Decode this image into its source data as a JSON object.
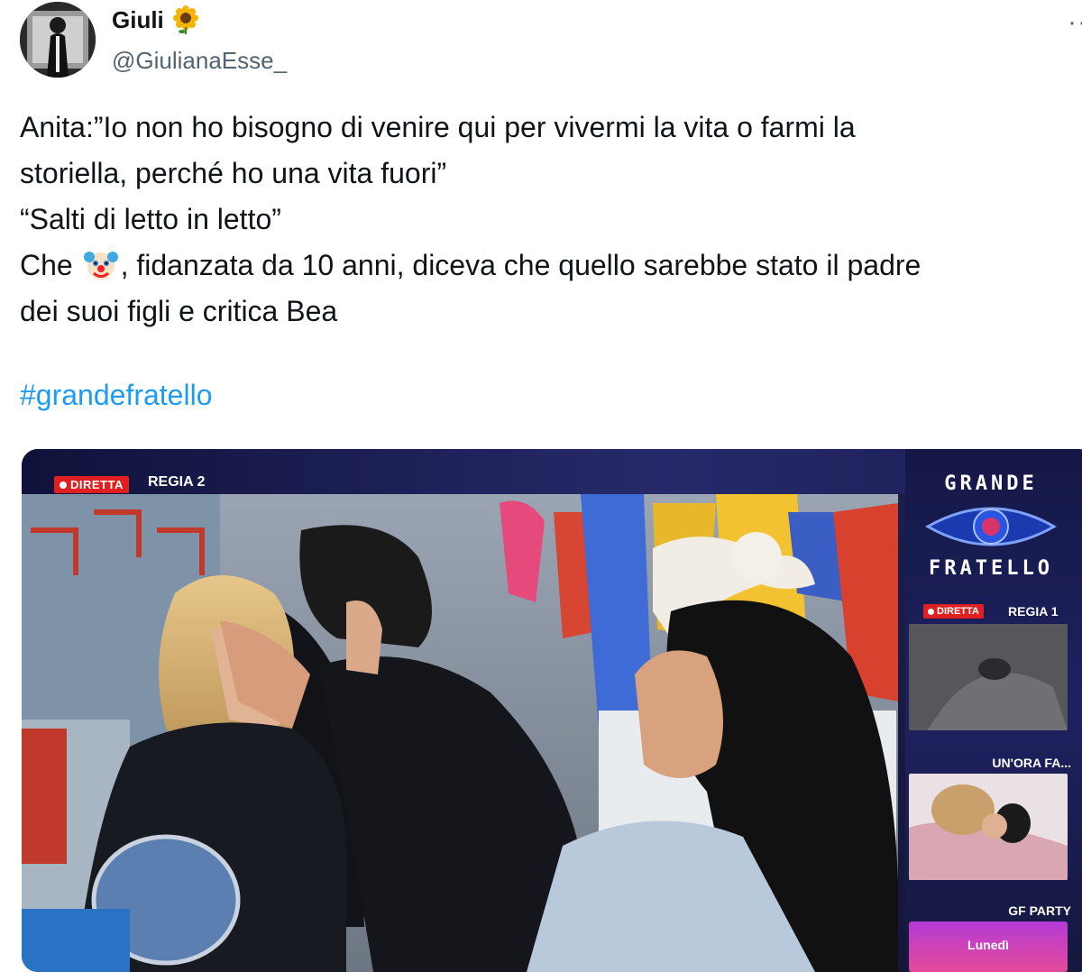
{
  "author": {
    "display_name": "Giuli",
    "name_emoji": "sunflower-emoji",
    "handle": "@GiulianaEsse_",
    "more_icon": "more-icon"
  },
  "tweet": {
    "line1": "Anita:”Io non ho bisogno di venire  qui per vivermi la vita o farmi la",
    "line2": "storiella, perché ho una vita fuori”",
    "line3": "“Salti di letto in letto”",
    "line4_before_emoji": "Che ",
    "line4_emoji": "clown-face-emoji",
    "line4_after_emoji": ", fidanzata da 10 anni, diceva che quello sarebbe stato il padre",
    "line5": "dei suoi figli e critica Bea",
    "hashtag": "#grandefratello"
  },
  "media": {
    "live_badge": "DIRETTA",
    "main_feed_label": "REGIA 2",
    "logo_line1": "GRANDE",
    "logo_line2": "FRATELLO",
    "side_live_badge": "DIRETTA",
    "side_feed_label": "REGIA 1",
    "hour_ago_label": "UN'ORA FA...",
    "party_label": "GF PARTY",
    "party_button": "Lunedì",
    "colors": {
      "live_red": "#e02020",
      "broadcast_navy": "#1c1f4a",
      "hashtag_blue": "#1d9bf0"
    }
  }
}
